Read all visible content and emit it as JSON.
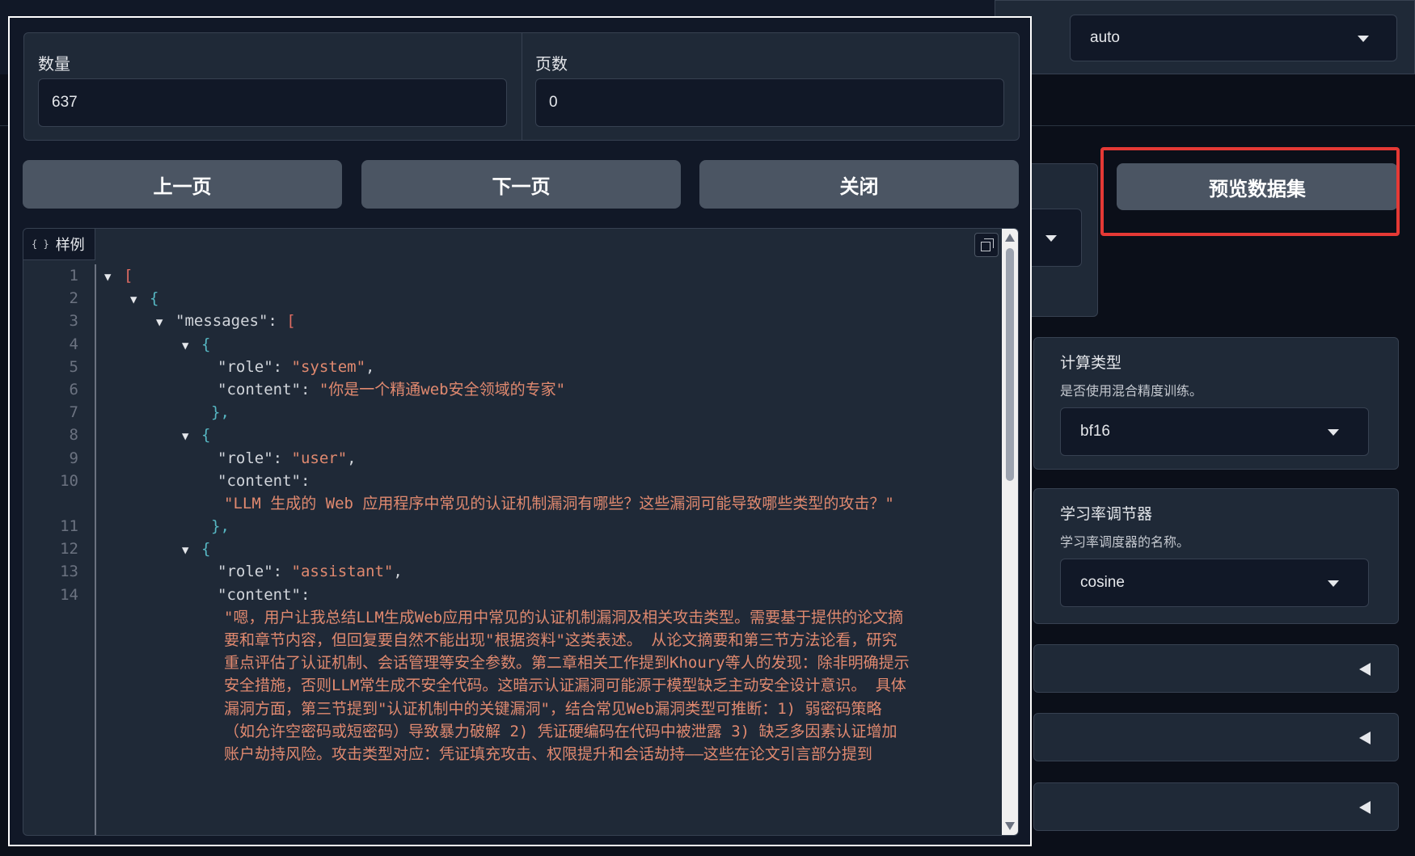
{
  "background": {
    "right_top_select_value": "auto"
  },
  "right_panel": {
    "preview_button_label": "预览数据集",
    "compute_type": {
      "label": "计算类型",
      "description": "是否使用混合精度训练。",
      "value": "bf16"
    },
    "lr_scheduler": {
      "label": "学习率调节器",
      "description": "学习率调度器的名称。",
      "value": "cosine"
    }
  },
  "modal": {
    "count_label": "数量",
    "count_value": "637",
    "page_label": "页数",
    "page_value": "0",
    "prev_button": "上一页",
    "next_button": "下一页",
    "close_button": "关闭",
    "code_tab_label": "样例",
    "code_tab_icon": "{ }",
    "line_numbers": [
      "1",
      "2",
      "3",
      "4",
      "5",
      "6",
      "7",
      "8",
      "9",
      "10",
      "",
      "11",
      "12",
      "13",
      "14"
    ],
    "code": {
      "l1_open": "[",
      "l2_open": "{",
      "l3_key": "\"messages\"",
      "l3_colon": ": ",
      "l3_open": "[",
      "l4_open": "{",
      "l5_key": "\"role\"",
      "l5_colon": ": ",
      "l5_value": "\"system\"",
      "l5_comma": ",",
      "l6_key": "\"content\"",
      "l6_colon": ": ",
      "l6_value": "\"你是一个精通web安全领域的专家\"",
      "l7_close": "},",
      "l8_open": "{",
      "l9_key": "\"role\"",
      "l9_colon": ": ",
      "l9_value": "\"user\"",
      "l9_comma": ",",
      "l10_key": "\"content\"",
      "l10_colon": ":",
      "l10_value": "\"LLM 生成的 Web 应用程序中常见的认证机制漏洞有哪些？这些漏洞可能导致哪些类型的攻击？\"",
      "l11_close": "},",
      "l12_open": "{",
      "l13_key": "\"role\"",
      "l13_colon": ": ",
      "l13_value": "\"assistant\"",
      "l13_comma": ",",
      "l14_key": "\"content\"",
      "l14_colon": ":",
      "l14_value": "\"嗯，用户让我总结LLM生成Web应用中常见的认证机制漏洞及相关攻击类型。需要基于提供的论文摘要和章节内容，但回复要自然不能出现\"根据资料\"这类表述。 从论文摘要和第三节方法论看，研究重点评估了认证机制、会话管理等安全参数。第二章相关工作提到Khoury等人的发现：除非明确提示安全措施，否则LLM常生成不安全代码。这暗示认证漏洞可能源于模型缺乏主动安全设计意识。 具体漏洞方面，第三节提到\"认证机制中的关键漏洞\"，结合常见Web漏洞类型可推断：1) 弱密码策略（如允许空密码或短密码）导致暴力破解 2) 凭证硬编码在代码中被泄露 3) 缺乏多因素认证增加账户劫持风险。攻击类型对应：凭证填充攻击、权限提升和会话劫持——这些在论文引言部分提到"
    }
  },
  "icons": [
    "copy-icon",
    "json-icon",
    "chevron-down-icon",
    "collapse-left-icon",
    "scroll-up-icon",
    "scroll-down-icon",
    "tree-toggle-icon"
  ]
}
